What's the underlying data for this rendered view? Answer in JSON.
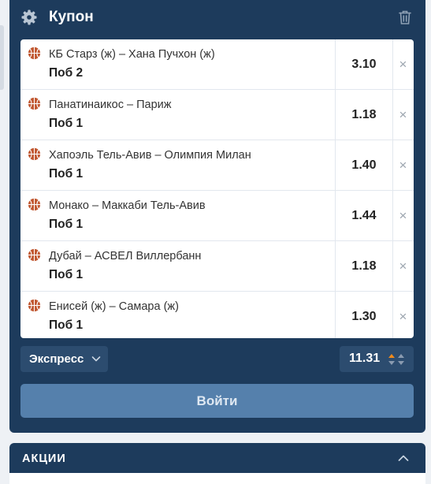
{
  "coupon": {
    "title": "Купон",
    "bets": [
      {
        "match": "КБ Старз (ж) – Хана Пучхон (ж)",
        "outcome": "Поб 2",
        "odd": "3.10"
      },
      {
        "match": "Панатинаикос – Париж",
        "outcome": "Поб 1",
        "odd": "1.18"
      },
      {
        "match": "Хапоэль Тель-Авив – Олимпия Милан",
        "outcome": "Поб 1",
        "odd": "1.40"
      },
      {
        "match": "Монако – Маккаби Тель-Авив",
        "outcome": "Поб 1",
        "odd": "1.44"
      },
      {
        "match": "Дубай – АСВЕЛ Виллербанн",
        "outcome": "Поб 1",
        "odd": "1.18"
      },
      {
        "match": "Енисей (ж) – Самара (ж)",
        "outcome": "Поб 1",
        "odd": "1.30"
      }
    ],
    "remove_symbol": "×",
    "bet_type": "Экспресс",
    "total_odd": "11.31",
    "login_label": "Войти"
  },
  "promo": {
    "title": "АКЦИИ"
  },
  "icons": {
    "sport": "basketball-icon",
    "settings": "gear-icon",
    "delete": "trash-icon"
  },
  "colors": {
    "panel": "#1d3b5c",
    "button": "#5580ac",
    "basketball": "#c0562f",
    "odds_up": "#f08a1c"
  }
}
